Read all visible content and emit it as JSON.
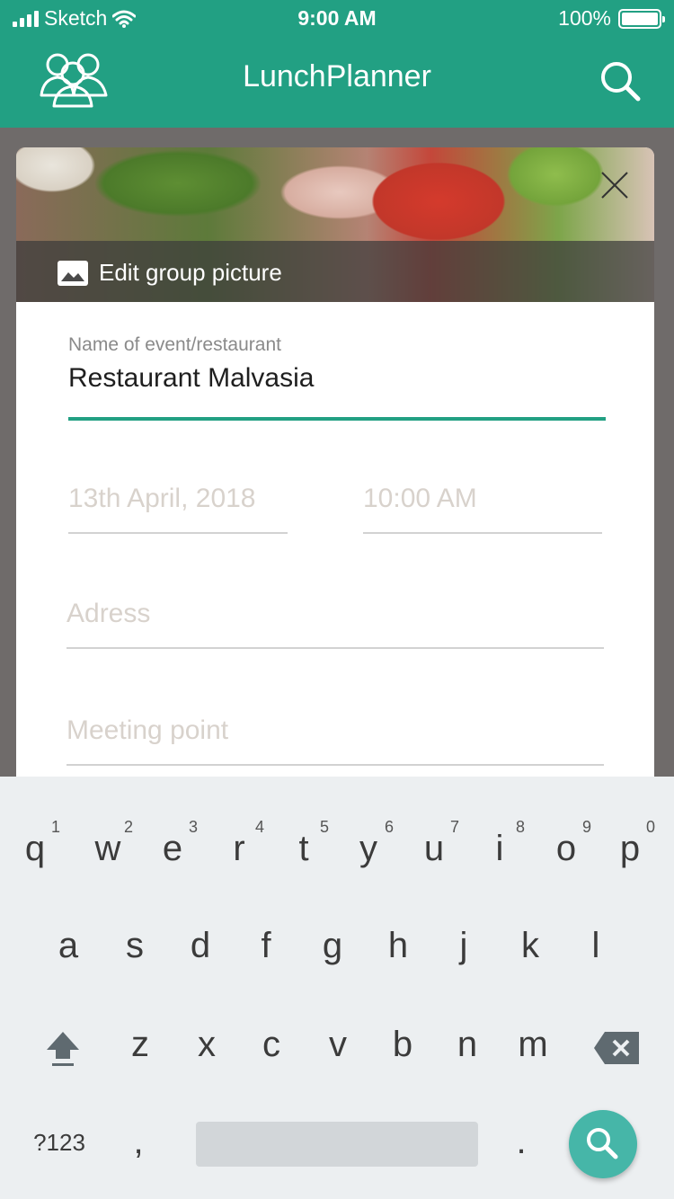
{
  "status_bar": {
    "carrier": "Sketch",
    "time": "9:00 AM",
    "battery": "100%"
  },
  "app_bar": {
    "title": "LunchPlanner",
    "left_icon": "group-icon",
    "right_icon": "search-icon"
  },
  "card": {
    "edit_picture_label": "Edit group picture",
    "name_field": {
      "label": "Name of event/restaurant",
      "value": "Restaurant Malvasia"
    },
    "date_field": {
      "placeholder": "13th April, 2018"
    },
    "time_field": {
      "placeholder": "10:00 AM"
    },
    "address_field": {
      "placeholder": "Adress"
    },
    "meeting_field": {
      "placeholder": "Meeting point"
    }
  },
  "keyboard": {
    "row1": [
      {
        "ch": "q",
        "num": "1"
      },
      {
        "ch": "w",
        "num": "2"
      },
      {
        "ch": "e",
        "num": "3"
      },
      {
        "ch": "r",
        "num": "4"
      },
      {
        "ch": "t",
        "num": "5"
      },
      {
        "ch": "y",
        "num": "6"
      },
      {
        "ch": "u",
        "num": "7"
      },
      {
        "ch": "i",
        "num": "8"
      },
      {
        "ch": "o",
        "num": "9"
      },
      {
        "ch": "p",
        "num": "0"
      }
    ],
    "row2": [
      "a",
      "s",
      "d",
      "f",
      "g",
      "h",
      "j",
      "k",
      "l"
    ],
    "row3": [
      "z",
      "x",
      "c",
      "v",
      "b",
      "n",
      "m"
    ],
    "symbols_label": "?123",
    "comma": ",",
    "period": "."
  },
  "colors": {
    "primary": "#22a083",
    "fab": "#46b6a8"
  }
}
